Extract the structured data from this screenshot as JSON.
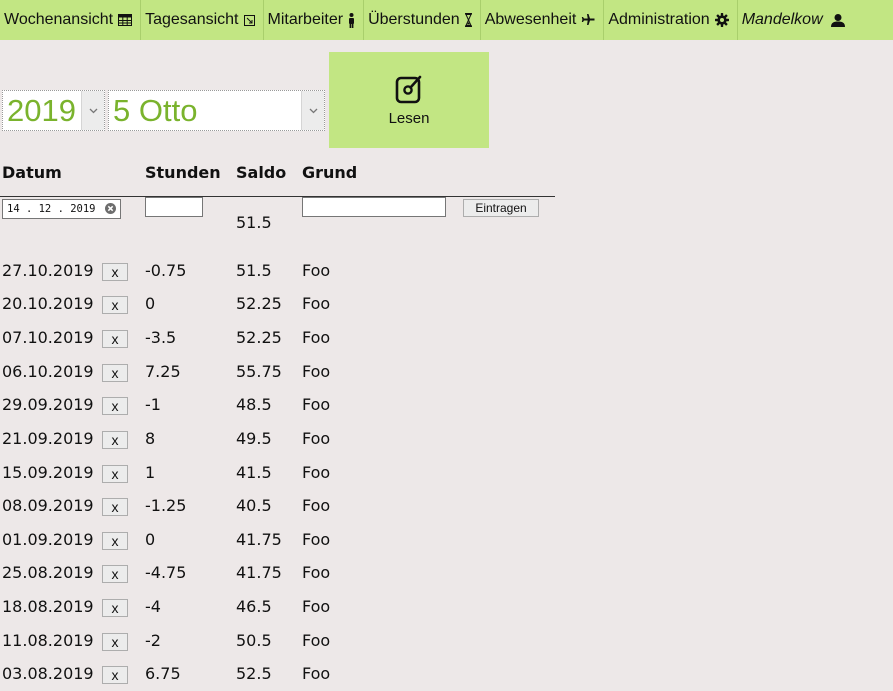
{
  "nav": {
    "items": [
      {
        "label": "Wochenansicht",
        "icon": "calendar-icon"
      },
      {
        "label": "Tagesansicht",
        "icon": "day-view-icon"
      },
      {
        "label": "Mitarbeiter",
        "icon": "person-icon"
      },
      {
        "label": "Überstunden",
        "icon": "hourglass-icon"
      },
      {
        "label": "Abwesenheit",
        "icon": "plane-icon"
      },
      {
        "label": "Administration",
        "icon": "gear-icon"
      },
      {
        "label": "Mandelkow",
        "icon": "user-icon"
      }
    ]
  },
  "controls": {
    "year": "2019",
    "employee": "5 Otto",
    "read_label": "Lesen"
  },
  "table": {
    "headers": {
      "date": "Datum",
      "hours": "Stunden",
      "saldo": "Saldo",
      "reason": "Grund"
    },
    "new_entry": {
      "date_value": "14.12.2019",
      "hours_value": "",
      "reason_value": "",
      "submit_label": "Eintragen",
      "current_saldo": "51.5"
    },
    "delete_label": "x",
    "rows": [
      {
        "date": "27.10.2019",
        "hours": "-0.75",
        "saldo": "51.5",
        "reason": "Foo"
      },
      {
        "date": "20.10.2019",
        "hours": "0",
        "saldo": "52.25",
        "reason": "Foo"
      },
      {
        "date": "07.10.2019",
        "hours": "-3.5",
        "saldo": "52.25",
        "reason": "Foo"
      },
      {
        "date": "06.10.2019",
        "hours": "7.25",
        "saldo": "55.75",
        "reason": "Foo"
      },
      {
        "date": "29.09.2019",
        "hours": "-1",
        "saldo": "48.5",
        "reason": "Foo"
      },
      {
        "date": "21.09.2019",
        "hours": "8",
        "saldo": "49.5",
        "reason": "Foo"
      },
      {
        "date": "15.09.2019",
        "hours": "1",
        "saldo": "41.5",
        "reason": "Foo"
      },
      {
        "date": "08.09.2019",
        "hours": "-1.25",
        "saldo": "40.5",
        "reason": "Foo"
      },
      {
        "date": "01.09.2019",
        "hours": "0",
        "saldo": "41.75",
        "reason": "Foo"
      },
      {
        "date": "25.08.2019",
        "hours": "-4.75",
        "saldo": "41.75",
        "reason": "Foo"
      },
      {
        "date": "18.08.2019",
        "hours": "-4",
        "saldo": "46.5",
        "reason": "Foo"
      },
      {
        "date": "11.08.2019",
        "hours": "-2",
        "saldo": "50.5",
        "reason": "Foo"
      },
      {
        "date": "03.08.2019",
        "hours": "6.75",
        "saldo": "52.5",
        "reason": "Foo"
      }
    ]
  }
}
